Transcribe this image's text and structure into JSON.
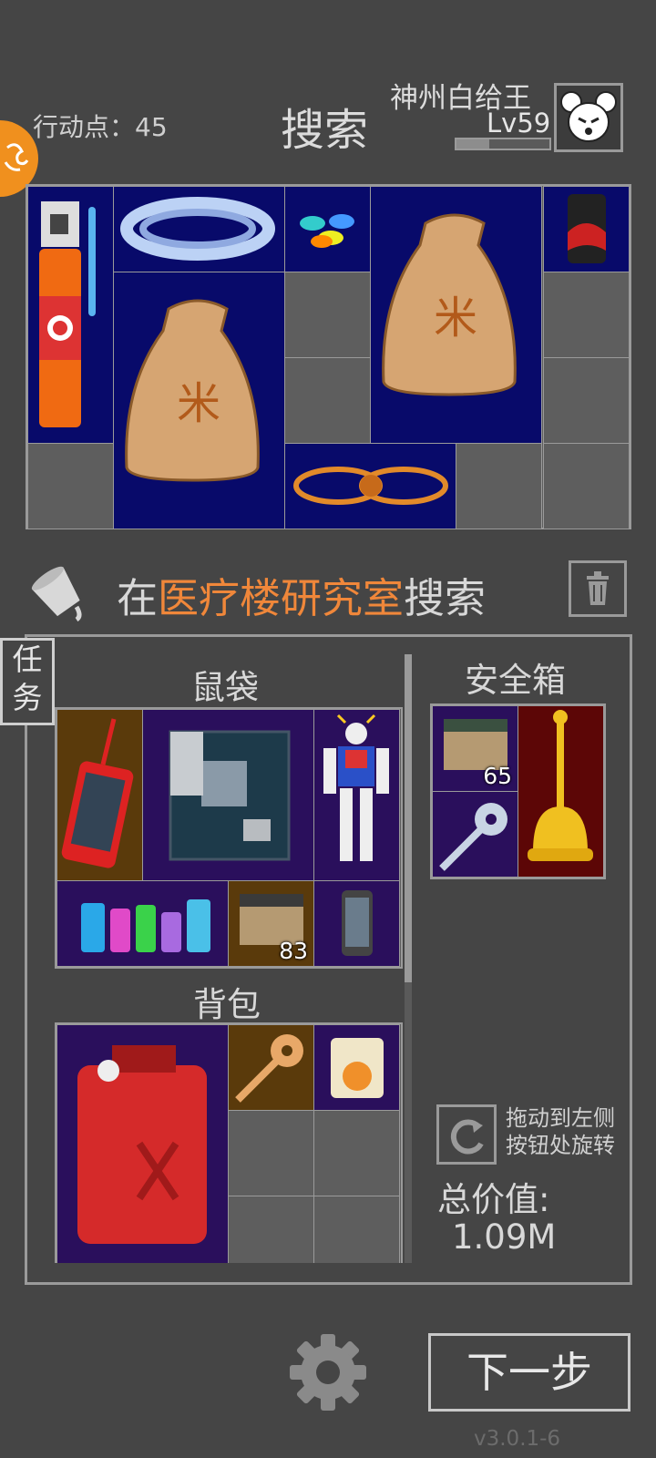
{
  "header": {
    "action_points": "行动点：45",
    "title": "搜索",
    "player_name": "神州白给王",
    "level": "Lv59",
    "xp_fraction": 0.35
  },
  "search_location": {
    "prefix": "在",
    "place": "医疗楼研究室",
    "suffix": "搜索"
  },
  "task_tab": {
    "line1": "任",
    "line2": "务"
  },
  "rat_bag": {
    "title": "鼠袋",
    "count_box": "83"
  },
  "backpack": {
    "title": "背包"
  },
  "safe_box": {
    "title": "安全箱",
    "count_box": "65"
  },
  "rotate_hint": {
    "line1": "拖动到左侧",
    "line2": "按钮处旋转"
  },
  "total_value": {
    "label": "总价值:",
    "value": "1.09M"
  },
  "next_button": "下一步",
  "version": "v3.0.1-6",
  "colors": {
    "accent_orange": "#f0873a",
    "loot_cell": "#080a6a",
    "empty_cell": "#5e5e5e",
    "item_purple": "#2a0f5c",
    "item_brown": "#5a3a0b",
    "item_maroon": "#5c0606"
  },
  "icons": [
    "orange-corner-icon",
    "rat-avatar-icon",
    "bucket-icon",
    "trash-icon",
    "gear-icon",
    "rotate-icon"
  ]
}
